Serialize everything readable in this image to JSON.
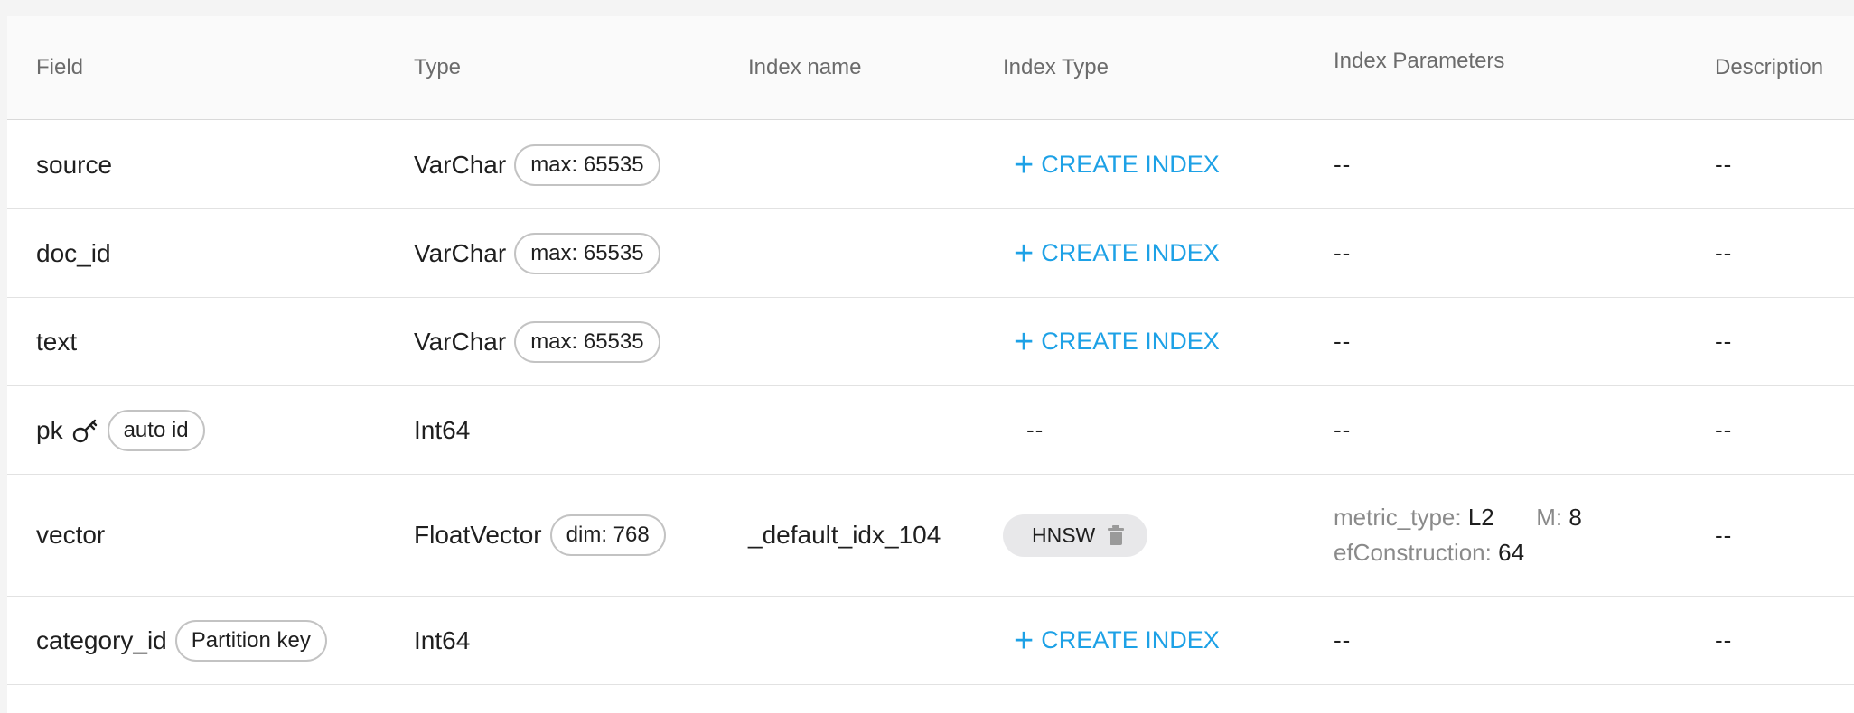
{
  "columns": {
    "field": "Field",
    "type": "Type",
    "index_name": "Index name",
    "index_type": "Index Type",
    "index_parameters": "Index Parameters",
    "description": "Description"
  },
  "create_index_label": "CREATE INDEX",
  "rows": [
    {
      "field": "source",
      "type": "VarChar",
      "type_tag": "max: 65535",
      "index_name": "",
      "index_param": "--",
      "description": "--"
    },
    {
      "field": "doc_id",
      "type": "VarChar",
      "type_tag": "max: 65535",
      "index_name": "",
      "index_param": "--",
      "description": "--"
    },
    {
      "field": "text",
      "type": "VarChar",
      "type_tag": "max: 65535",
      "index_name": "",
      "index_param": "--",
      "description": "--"
    },
    {
      "field": "pk",
      "field_tag": "auto id",
      "type": "Int64",
      "index_type": "--",
      "index_param": "--",
      "description": "--"
    },
    {
      "field": "vector",
      "type": "FloatVector",
      "type_tag": "dim: 768",
      "index_name": "_default_idx_104",
      "index_type": "HNSW",
      "params": {
        "metric_type_key": "metric_type:",
        "metric_type_val": "L2",
        "m_key": "M:",
        "m_val": "8",
        "ef_key": "efConstruction:",
        "ef_val": "64"
      },
      "description": "--"
    },
    {
      "field": "category_id",
      "field_tag": "Partition key",
      "type": "Int64",
      "index_param": "--",
      "description": "--"
    }
  ],
  "icons": {
    "key": "key-icon",
    "plus": "plus-icon",
    "trash": "trash-icon"
  },
  "colors": {
    "accent": "#1da1e6",
    "chip_bg": "#e8e8ea",
    "muted": "#8a8a8a"
  }
}
